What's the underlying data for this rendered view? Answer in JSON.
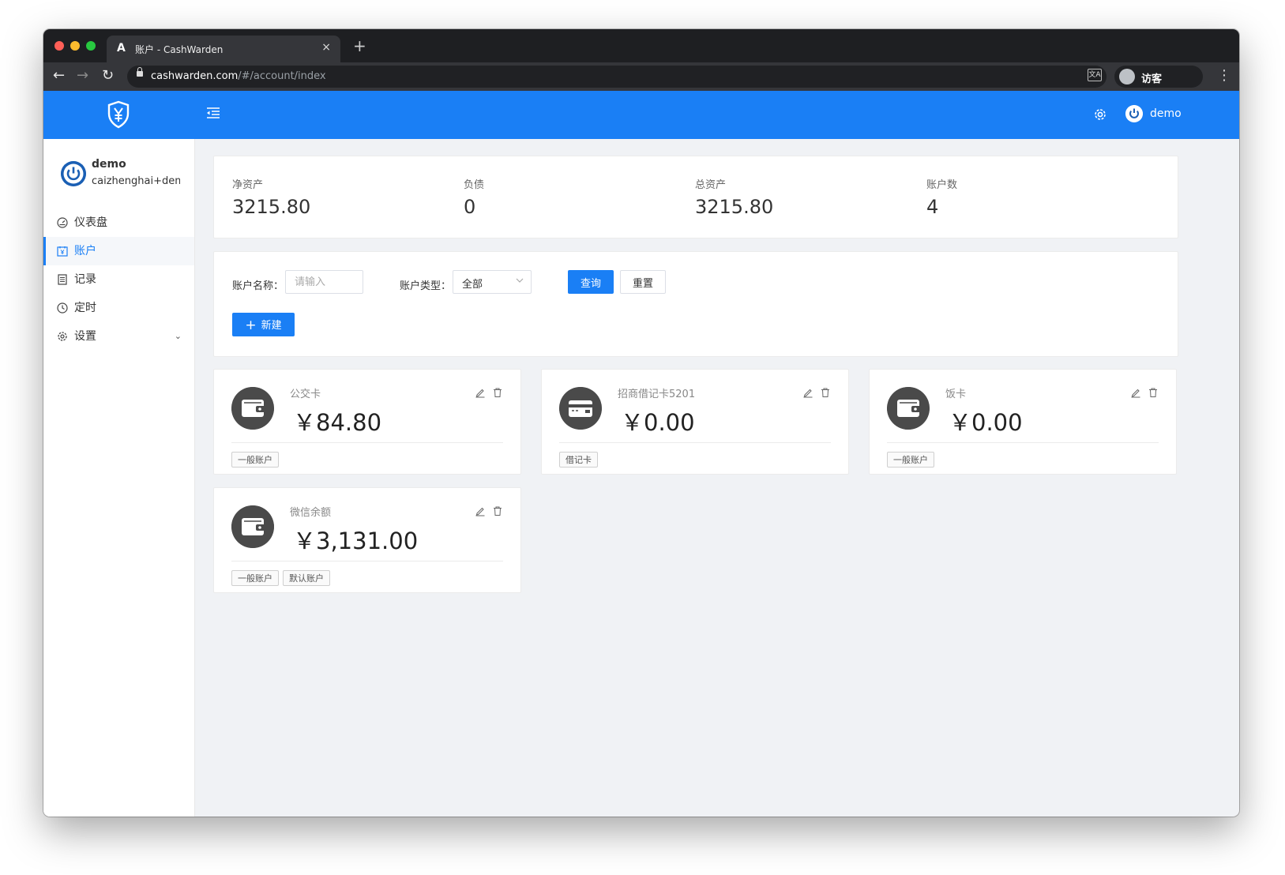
{
  "browser": {
    "tab_title": "账户 - CashWarden",
    "tab_favicon": "A",
    "new_tab": "+",
    "close": "×",
    "url_host": "cashwarden.com",
    "url_path": "/#/account/index",
    "profile_label": "访客",
    "translate_badge": "文A"
  },
  "header": {
    "username": "demo",
    "accent": "#1a7ff5"
  },
  "sidebar": {
    "user": {
      "name": "demo",
      "email": "caizhenghai+demo@qq.com"
    },
    "items": [
      {
        "label": "仪表盘",
        "icon": "dashboard-icon"
      },
      {
        "label": "账户",
        "icon": "account-book-icon",
        "active": true
      },
      {
        "label": "记录",
        "icon": "record-list-icon"
      },
      {
        "label": "定时",
        "icon": "clock-icon"
      },
      {
        "label": "设置",
        "icon": "gear-icon",
        "arrow": "⌄"
      }
    ]
  },
  "stats": [
    {
      "label": "净资产",
      "value": "3215.80"
    },
    {
      "label": "负债",
      "value": "0"
    },
    {
      "label": "总资产",
      "value": "3215.80"
    },
    {
      "label": "账户数",
      "value": "4"
    }
  ],
  "filter": {
    "name_label": "账户名称：",
    "name_placeholder": "请输入",
    "type_label": "账户类型：",
    "type_value": "全部",
    "query_label": "查询",
    "reset_label": "重置",
    "new_label": "新建"
  },
  "accounts": [
    {
      "name": "公交卡",
      "balance": "￥84.80",
      "icon": "wallet-icon",
      "tags": [
        "一般账户"
      ]
    },
    {
      "name": "招商借记卡5201",
      "balance": "￥0.00",
      "icon": "credit-card-icon",
      "tags": [
        "借记卡"
      ]
    },
    {
      "name": "饭卡",
      "balance": "￥0.00",
      "icon": "wallet-icon",
      "tags": [
        "一般账户"
      ]
    },
    {
      "name": "微信余额",
      "balance": "￥3,131.00",
      "icon": "wallet-icon",
      "tags": [
        "一般账户",
        "默认账户"
      ]
    }
  ]
}
